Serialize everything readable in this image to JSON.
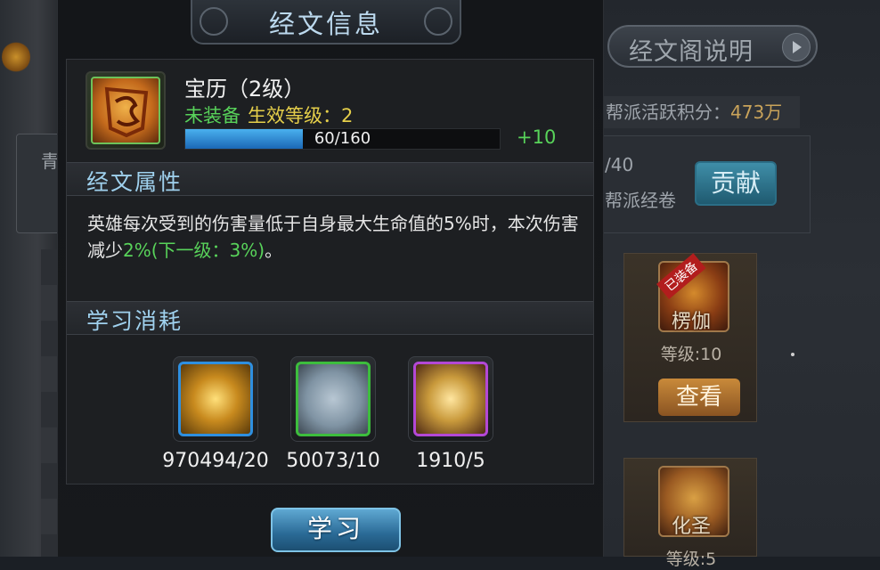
{
  "background": {
    "rules_button": "经文阁说明",
    "active_points_label": "帮派活跃积分：",
    "active_points_value": "473万",
    "contribute_count": "/40",
    "guild_library": "帮派经卷",
    "contribute_button": "贡献",
    "left_strip_text": "青",
    "cards": [
      {
        "name": "楞伽",
        "level": "等级:10",
        "ribbon": "已装备",
        "view_button": "查看"
      },
      {
        "name": "化圣",
        "level": "等级:5"
      }
    ]
  },
  "modal": {
    "title": "经文信息",
    "item": {
      "name": "宝历（2级）",
      "status_unequipped": "未装备",
      "status_effect": "生效等级：2",
      "exp_text": "60/160",
      "exp_fraction": 0.375,
      "exp_plus": "+10"
    },
    "attributes_title": "经文属性",
    "description_main": "英雄每次受到的伤害量低于自身最大生命值的5%时，本次伤害减少",
    "description_highlight": "2%(下一级：3%)",
    "description_end": "。",
    "cost_title": "学习消耗",
    "costs": [
      {
        "icon": "gold-medal-icon",
        "value": "970494/20"
      },
      {
        "icon": "scroll-icon",
        "value": "50073/10"
      },
      {
        "icon": "golden-scroll-icon",
        "value": "1910/5"
      }
    ],
    "learn_button": "学习"
  }
}
